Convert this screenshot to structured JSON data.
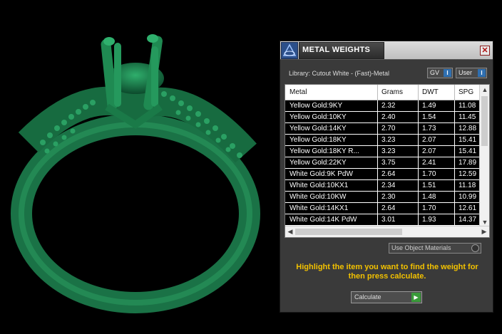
{
  "panel": {
    "title": "METAL WEIGHTS",
    "close_label": "✕",
    "library_label": "Library: Cutout White - (Fast)-Metal",
    "gv_label": "GV",
    "user_label": "User",
    "info_glyph": "I",
    "use_object_materials_label": "Use Object Materials",
    "hint": "Highlight the item you want to find the weight for then press calculate.",
    "calculate_label": "Calculate",
    "calculate_glyph": "▶"
  },
  "table": {
    "headers": {
      "metal": "Metal",
      "grams": "Grams",
      "dwt": "DWT",
      "spg": "SPG"
    },
    "rows": [
      {
        "metal": "Yellow Gold:9KY",
        "grams": "2.32",
        "dwt": "1.49",
        "spg": "11.08"
      },
      {
        "metal": "Yellow Gold:10KY",
        "grams": "2.40",
        "dwt": "1.54",
        "spg": "11.45"
      },
      {
        "metal": "Yellow Gold:14KY",
        "grams": "2.70",
        "dwt": "1.73",
        "spg": "12.88"
      },
      {
        "metal": "Yellow Gold:18KY",
        "grams": "3.23",
        "dwt": "2.07",
        "spg": "15.41"
      },
      {
        "metal": "Yellow Gold:18KY R...",
        "grams": "3.23",
        "dwt": "2.07",
        "spg": "15.41"
      },
      {
        "metal": "Yellow Gold:22KY",
        "grams": "3.75",
        "dwt": "2.41",
        "spg": "17.89"
      },
      {
        "metal": "White Gold:9K PdW",
        "grams": "2.64",
        "dwt": "1.70",
        "spg": "12.59"
      },
      {
        "metal": "White Gold:10KX1",
        "grams": "2.34",
        "dwt": "1.51",
        "spg": "11.18"
      },
      {
        "metal": "White Gold:10KW",
        "grams": "2.30",
        "dwt": "1.48",
        "spg": "10.99"
      },
      {
        "metal": "White Gold:14KX1",
        "grams": "2.64",
        "dwt": "1.70",
        "spg": "12.61"
      },
      {
        "metal": "White Gold:14K PdW",
        "grams": "3.01",
        "dwt": "1.93",
        "spg": "14.37"
      }
    ]
  },
  "scroll": {
    "up": "▲",
    "down": "▼",
    "left": "◀",
    "right": "▶"
  },
  "colors": {
    "ring": "#1f7a4e",
    "panel_bg": "#3a3a3a",
    "hint": "#f2c100",
    "row_bg": "#000000"
  }
}
